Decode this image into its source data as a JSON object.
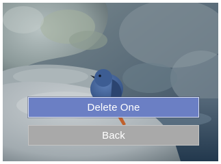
{
  "photo": {
    "subject": "bird-on-rock-photo"
  },
  "menu": {
    "items": [
      {
        "label": "Delete One",
        "selected": true
      },
      {
        "label": "Back",
        "selected": false
      }
    ]
  },
  "colors": {
    "selected_button": "#6b7fc4",
    "normal_button": "#a9a9a9",
    "button_text": "#ffffff"
  }
}
